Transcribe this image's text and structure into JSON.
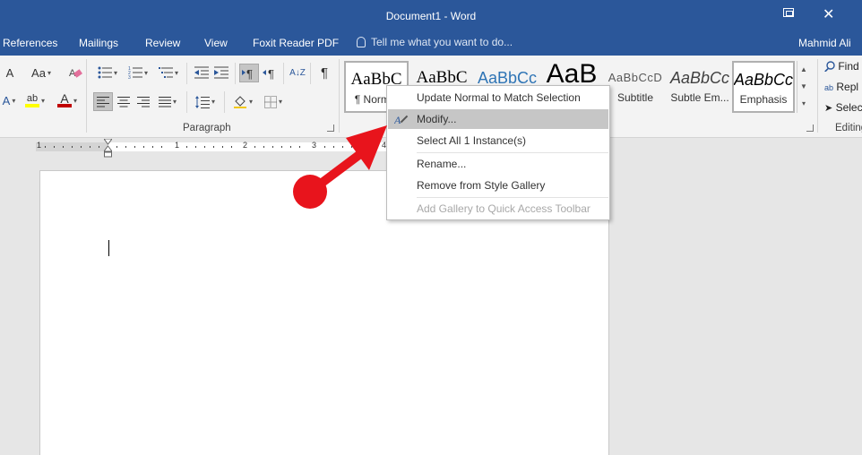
{
  "window": {
    "title": "Document1 - Word"
  },
  "tabs": [
    "References",
    "Mailings",
    "Review",
    "View",
    "Foxit Reader PDF"
  ],
  "tell_me": "Tell me what you want to do...",
  "user": "Mahmid Ali",
  "ribbon": {
    "paragraph_label": "Paragraph",
    "editing_label": "Editing",
    "font_case_label": "Aa",
    "font_color_letter": "A",
    "highlight_letters": "ab",
    "grow_letter": "A",
    "sort_label": "A↓Z",
    "pilcrow": "¶"
  },
  "styles": [
    {
      "sample": "AaBbC",
      "name": "¶ Normal"
    },
    {
      "sample": "AaBbC",
      "name": ""
    },
    {
      "sample": "AaBbCc",
      "name": ""
    },
    {
      "sample": "AaB",
      "name": ""
    },
    {
      "sample": "AaBbCcD",
      "name": "Subtitle"
    },
    {
      "sample": "AaBbCc",
      "name": "Subtle Em..."
    },
    {
      "sample": "AaBbCc",
      "name": "Emphasis"
    }
  ],
  "editing": {
    "find": "Find",
    "replace": "Repl",
    "select": "Selec"
  },
  "ruler": {
    "numbers": [
      "1",
      "1",
      "2",
      "3",
      "4"
    ]
  },
  "context_menu": {
    "items": [
      {
        "label": "Update Normal to Match Selection",
        "state": "normal"
      },
      {
        "label": "Modify...",
        "state": "highlighted"
      },
      {
        "label": "Select All 1 Instance(s)",
        "state": "normal"
      },
      {
        "label": "Rename...",
        "state": "normal"
      },
      {
        "label": "Remove from Style Gallery",
        "state": "normal"
      },
      {
        "label": "Add Gallery to Quick Access Toolbar",
        "state": "disabled"
      }
    ]
  },
  "colors": {
    "title_bar": "#2b579a",
    "annotation_arrow": "#e8141c"
  }
}
